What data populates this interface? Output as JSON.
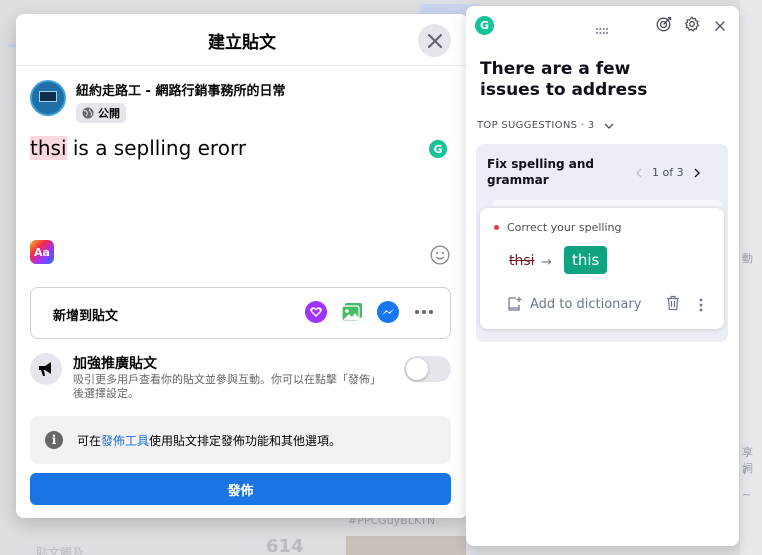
{
  "background": {
    "right_fragments": [
      "動",
      "享詞",
      "?",
      "~"
    ],
    "bottom_count": "614",
    "bottom_label": "貼文觸及",
    "hashtag": "#PPCGuyBLKTN"
  },
  "fb_modal": {
    "title": "建立貼文",
    "page_name": "紐約走路工 - 網路行銷事務所的日常",
    "privacy": "公開",
    "post_text": {
      "misspelled": "thsi",
      "rest": " is a seplling erorr"
    },
    "add_to_post_label": "新增到貼文",
    "boost": {
      "title": "加強推廣貼文",
      "description": "吸引更多用戶查看你的貼文並參與互動。你可以在點擊「發佈」後選擇設定。",
      "enabled": false
    },
    "info": {
      "prefix": "可在",
      "link": "發佈工具",
      "suffix": "使用貼文排定發佈功能和其他選項。"
    },
    "publish_label": "發佈"
  },
  "grammarly": {
    "logo_letter": "G",
    "heading": "There are a few issues to address",
    "top_suggestions": "TOP SUGGESTIONS · 3",
    "group_title": "Fix spelling and grammar",
    "pager": "1 of 3",
    "card": {
      "category": "Correct your spelling",
      "wrong": "thsi",
      "arrow": "→",
      "fix": "this",
      "add_to_dictionary": "Add to dictionary"
    }
  },
  "colors": {
    "facebook_blue": "#1b74e4",
    "grammarly_green": "#15c39a",
    "fix_green": "#10a37f",
    "error_highlight": "#fbd8dd"
  }
}
